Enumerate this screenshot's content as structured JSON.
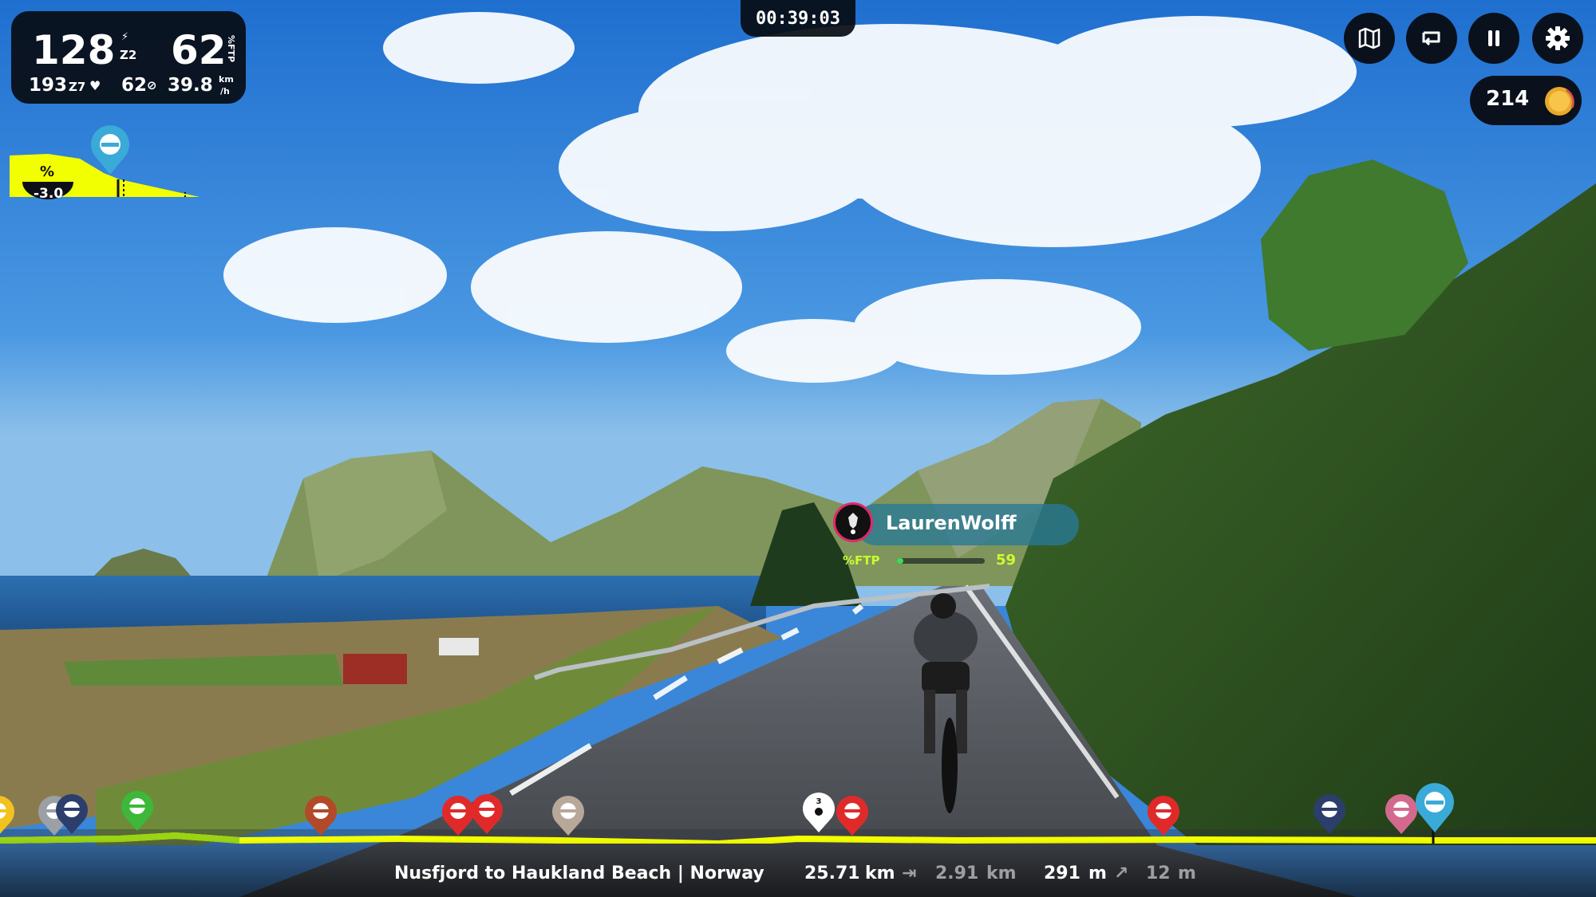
{
  "stats": {
    "power": "128",
    "power_zone": "Z2",
    "ftp_percent": "62",
    "ftp_unit": "%FTP",
    "heart_rate": "193",
    "hr_zone": "Z7",
    "cadence": "62",
    "speed": "39.8",
    "speed_unit_top": "km",
    "speed_unit_bottom": "/h"
  },
  "timer": "00:39:03",
  "toolbar": {
    "map_icon": "map-icon",
    "loop_icon": "loop-icon",
    "pause_icon": "pause-icon",
    "settings_icon": "gear-icon"
  },
  "coins": {
    "value": "214"
  },
  "gradient": {
    "label": "%",
    "value": "-3.0"
  },
  "rider": {
    "name": "LaurenWolff",
    "ftp_label": "%FTP",
    "ftp_value": "59",
    "ftp_fill": 0.07
  },
  "route": {
    "name": "Nusfjord to Haukland Beach | Norway",
    "distance": "25.71",
    "distance_unit": "km",
    "remaining": "2.91",
    "remaining_unit": "km",
    "elevation": "291",
    "elevation_unit": "m",
    "climb": "12",
    "climb_unit": "m"
  },
  "colors": {
    "accent_yellow": "#f2ff00",
    "ftp_green": "#c8ff2e",
    "panel_dark": "#080c12"
  }
}
